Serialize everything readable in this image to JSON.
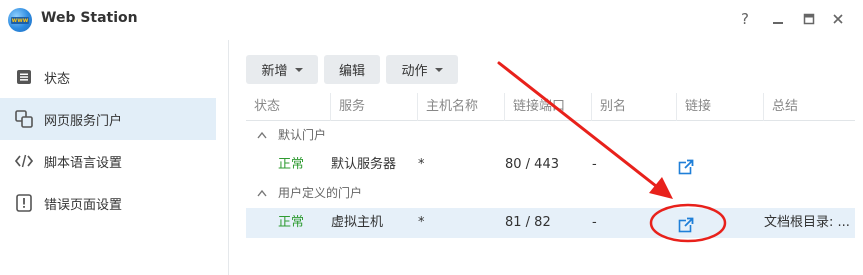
{
  "window": {
    "title": "Web Station",
    "logo_text": "www",
    "help_icon": "?",
    "controls": [
      "minimize-icon",
      "maximize-icon",
      "close-icon"
    ]
  },
  "sidebar": {
    "items": [
      {
        "label": "状态",
        "icon": "list-icon",
        "active": false
      },
      {
        "label": "网页服务门户",
        "icon": "portal-icon",
        "active": true
      },
      {
        "label": "脚本语言设置",
        "icon": "code-icon",
        "active": false
      },
      {
        "label": "错误页面设置",
        "icon": "warning-icon",
        "active": false
      }
    ]
  },
  "toolbar": {
    "add_label": "新增",
    "edit_label": "编辑",
    "action_label": "动作"
  },
  "table": {
    "columns": [
      "状态",
      "服务",
      "主机名称",
      "链接端口",
      "别名",
      "链接",
      "总结"
    ],
    "groups": [
      {
        "label": "默认门户",
        "rows": [
          {
            "status": "正常",
            "service": "默认服务器",
            "host": "*",
            "port": "80 / 443",
            "alias": "-",
            "link_icon": "external-link-icon",
            "summary": "",
            "selected": false
          }
        ]
      },
      {
        "label": "用户定义的门户",
        "rows": [
          {
            "status": "正常",
            "service": "虚拟主机",
            "host": "*",
            "port": "81 / 82",
            "alias": "-",
            "link_icon": "external-link-icon",
            "summary": "文档根目录: ...",
            "selected": true
          }
        ]
      }
    ]
  },
  "colors": {
    "accent": "#1f7fd8",
    "status_ok": "#2f9b32",
    "annotation": "#e8211b",
    "sidebar_active": "#e2eef8",
    "row_selected": "#e6f0f9"
  }
}
